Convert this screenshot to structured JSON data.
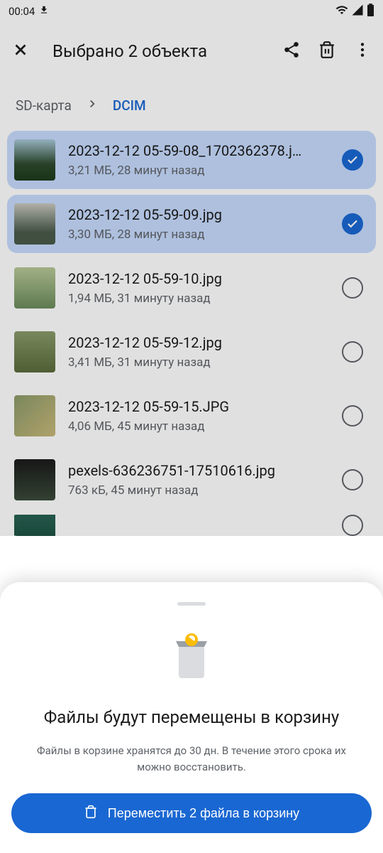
{
  "status": {
    "time": "00:04"
  },
  "toolbar": {
    "title": "Выбрано 2 объекта"
  },
  "breadcrumb": {
    "root": "SD-карта",
    "current": "DCIM"
  },
  "files": [
    {
      "name": "2023-12-12 05-59-08_1702362378.j…",
      "meta": "3,21 МБ, 28 минут назад",
      "selected": true
    },
    {
      "name": "2023-12-12 05-59-09.jpg",
      "meta": "3,30 МБ, 28 минут назад",
      "selected": true
    },
    {
      "name": "2023-12-12 05-59-10.jpg",
      "meta": "1,94 МБ, 31 минуту назад",
      "selected": false
    },
    {
      "name": "2023-12-12 05-59-12.jpg",
      "meta": "3,41 МБ, 31 минуту назад",
      "selected": false
    },
    {
      "name": "2023-12-12 05-59-15.JPG",
      "meta": "4,06 МБ, 45 минут назад",
      "selected": false
    },
    {
      "name": "pexels-636236751-17510616.jpg",
      "meta": "763 кБ, 45 минут назад",
      "selected": false
    }
  ],
  "sheet": {
    "title": "Файлы будут перемещены в корзину",
    "desc": "Файлы в корзине хранятся до 30 дн. В течение этого срока их можно восстановить.",
    "button": "Переместить 2 файла в корзину"
  }
}
